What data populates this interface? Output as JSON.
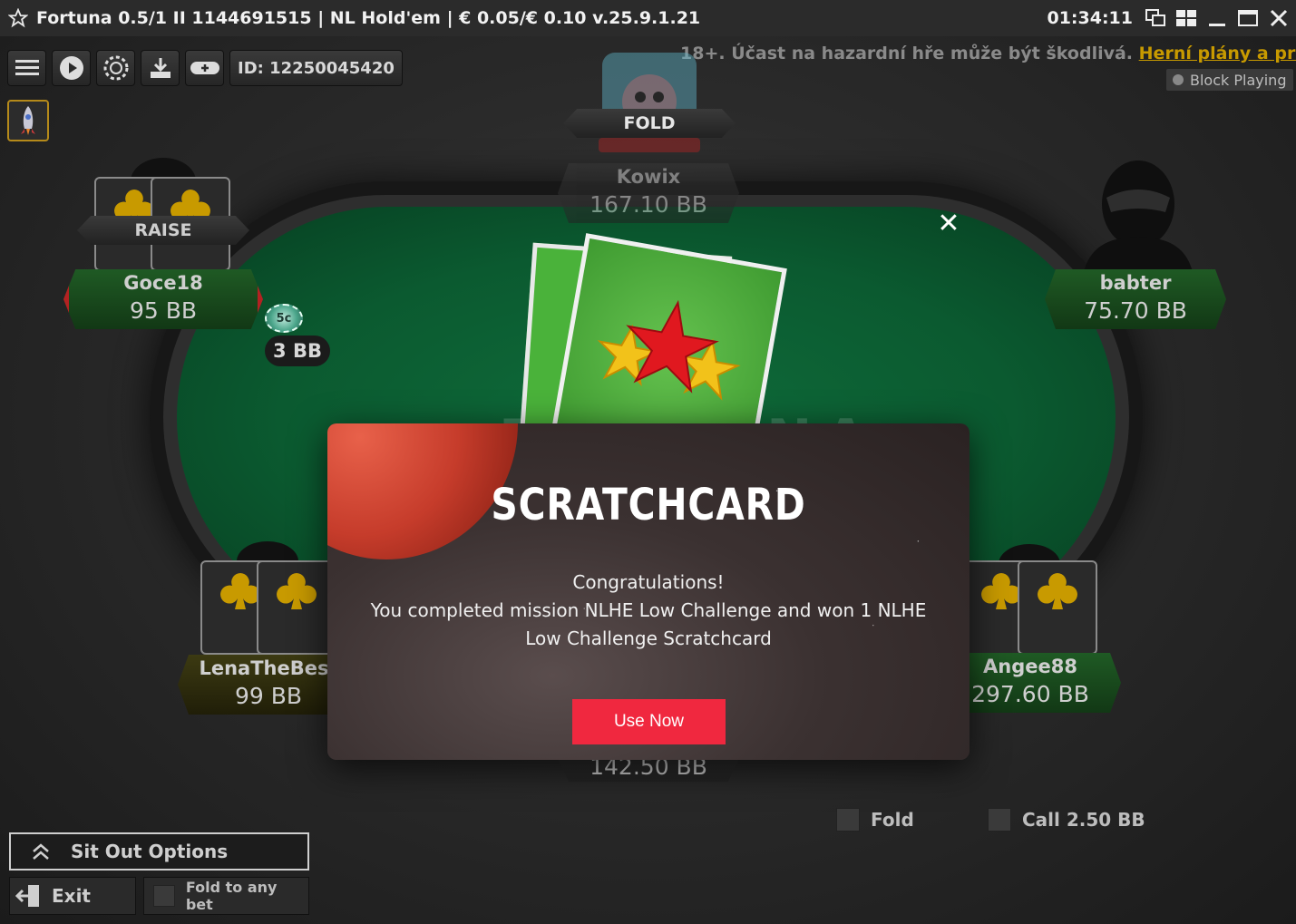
{
  "window": {
    "title": "Fortuna 0.5/1 II 1144691515  |  NL Hold'em  |  € 0.05/€ 0.10 v.25.9.1.21",
    "clock": "01:34:11"
  },
  "toolbar": {
    "table_id": "ID: 12250045420"
  },
  "disclaimer": {
    "text": "18+. Účast na hazardní hře může být škodlivá. ",
    "link": "Herní plány a pravidla."
  },
  "block_playing": "Block Playing",
  "table": {
    "felt_logo": "FORTUNA"
  },
  "players": {
    "top": {
      "action": "FOLD",
      "name": "Kowix",
      "stack": "167.10 BB"
    },
    "top_left": {
      "action": "RAISE",
      "name": "Goce18",
      "stack": "95 BB"
    },
    "top_right": {
      "name": "babter",
      "stack": "75.70 BB"
    },
    "bottom_left": {
      "name": "LenaTheBest",
      "stack": "99 BB"
    },
    "bottom_right": {
      "name": "Angee88",
      "stack": "297.60 BB"
    },
    "hero": {
      "stack": "142.50 BB"
    }
  },
  "bet": {
    "chip_label": "5c",
    "amount": "3 BB"
  },
  "modal": {
    "title": "SCRATCHCARD",
    "line1": "Congratulations!",
    "line2": "You completed mission NLHE Low Challenge and won 1 NLHE Low Challenge Scratchcard",
    "button": "Use Now"
  },
  "actions": {
    "fold": "Fold",
    "call": "Call 2.50 BB"
  },
  "bottom": {
    "sit_out": "Sit Out Options",
    "exit": "Exit",
    "fold_any": "Fold to any bet"
  },
  "colors": {
    "accent": "#f0283f",
    "felt": "#0b5a30",
    "link": "#c89a00"
  }
}
